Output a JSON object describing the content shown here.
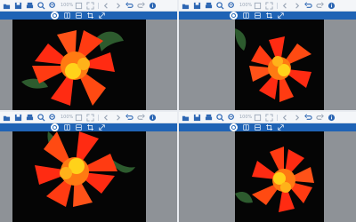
{
  "panes": [
    {
      "id": "q1",
      "zoom": "100%",
      "icons": [
        "folder-icon",
        "save-icon",
        "print-icon",
        "zoom-in-icon",
        "zoom-out-icon",
        "fit-icon",
        "fullscreen-icon",
        "arrow-left-icon",
        "arrow-right-icon",
        "undo-icon",
        "redo-icon",
        "info-icon"
      ],
      "mode_buttons": [
        "rotate-icon",
        "compare-icon",
        "split-icon",
        "crop-icon",
        "resize-icon"
      ]
    },
    {
      "id": "q2",
      "zoom": "100%",
      "icons": [
        "folder-icon",
        "save-icon",
        "print-icon",
        "zoom-in-icon",
        "zoom-out-icon",
        "fit-icon",
        "fullscreen-icon",
        "arrow-left-icon",
        "arrow-right-icon",
        "undo-icon",
        "redo-icon",
        "info-icon"
      ],
      "mode_buttons": [
        "rotate-icon",
        "compare-icon",
        "split-icon",
        "crop-icon",
        "resize-icon"
      ]
    },
    {
      "id": "q3",
      "zoom": "100%",
      "icons": [
        "folder-icon",
        "save-icon",
        "print-icon",
        "zoom-in-icon",
        "zoom-out-icon",
        "fit-icon",
        "fullscreen-icon",
        "arrow-left-icon",
        "arrow-right-icon",
        "undo-icon",
        "redo-icon",
        "info-icon"
      ],
      "mode_buttons": [
        "rotate-icon",
        "compare-icon",
        "split-icon",
        "crop-icon",
        "resize-icon"
      ]
    },
    {
      "id": "q4",
      "zoom": "100%",
      "icons": [
        "folder-icon",
        "save-icon",
        "print-icon",
        "zoom-in-icon",
        "zoom-out-icon",
        "fit-icon",
        "fullscreen-icon",
        "arrow-left-icon",
        "arrow-right-icon",
        "undo-icon",
        "redo-icon",
        "info-icon"
      ],
      "mode_buttons": [
        "rotate-icon",
        "compare-icon",
        "split-icon",
        "crop-icon",
        "resize-icon"
      ]
    }
  ],
  "colors": {
    "toolbar_bg": "#f4f6f9",
    "mode_bar": "#1f63b5",
    "workspace": "#8e9297",
    "photo_bg": "#050505",
    "flower_red": "#ff2b12",
    "flower_orange": "#ff7a12",
    "flower_yellow": "#ffd21a",
    "leaf_green": "#2d5b2e"
  }
}
